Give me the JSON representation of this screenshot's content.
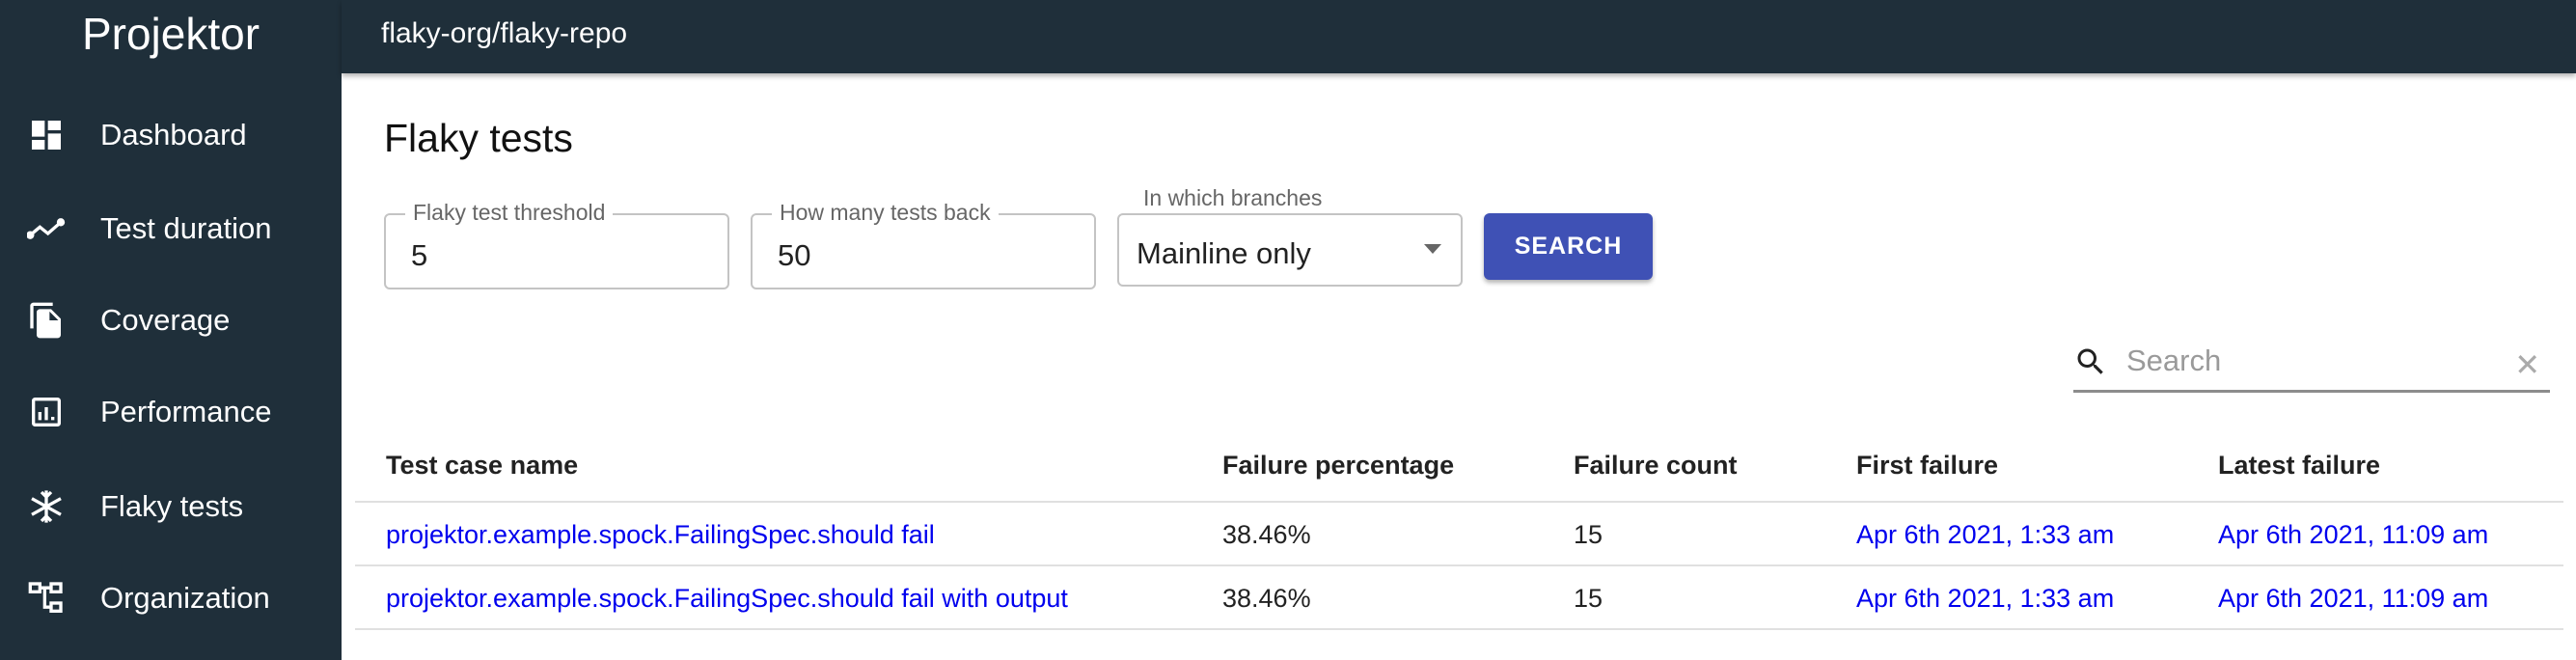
{
  "app": {
    "name": "Projektor"
  },
  "header": {
    "repo": "flaky-org/flaky-repo"
  },
  "sidebar": {
    "items": [
      {
        "label": "Dashboard",
        "icon": "dashboard-icon"
      },
      {
        "label": "Test duration",
        "icon": "timeline-icon"
      },
      {
        "label": "Coverage",
        "icon": "file-copy-icon"
      },
      {
        "label": "Performance",
        "icon": "bar-chart-icon"
      },
      {
        "label": "Flaky tests",
        "icon": "snowflake-icon"
      },
      {
        "label": "Organization",
        "icon": "account-tree-icon"
      }
    ]
  },
  "page": {
    "title": "Flaky tests"
  },
  "form": {
    "threshold": {
      "label": "Flaky test threshold",
      "value": "5"
    },
    "tests_back": {
      "label": "How many tests back",
      "value": "50"
    },
    "branches": {
      "label": "In which branches",
      "value": "Mainline only"
    },
    "search_label": "SEARCH"
  },
  "search": {
    "placeholder": "Search",
    "clear": "✕"
  },
  "table": {
    "columns": [
      "Test case name",
      "Failure percentage",
      "Failure count",
      "First failure",
      "Latest failure"
    ],
    "rows": [
      [
        "projektor.example.spock.FailingSpec.should fail",
        "38.46%",
        "15",
        "Apr 6th 2021, 1:33 am",
        "Apr 6th 2021, 11:09 am"
      ],
      [
        "projektor.example.spock.FailingSpec.should fail with output",
        "38.46%",
        "15",
        "Apr 6th 2021, 1:33 am",
        "Apr 6th 2021, 11:09 am"
      ]
    ]
  },
  "colors": {
    "sidebar": "#1f2f3a",
    "accent": "#3f51b5",
    "link": "#0000ee"
  }
}
